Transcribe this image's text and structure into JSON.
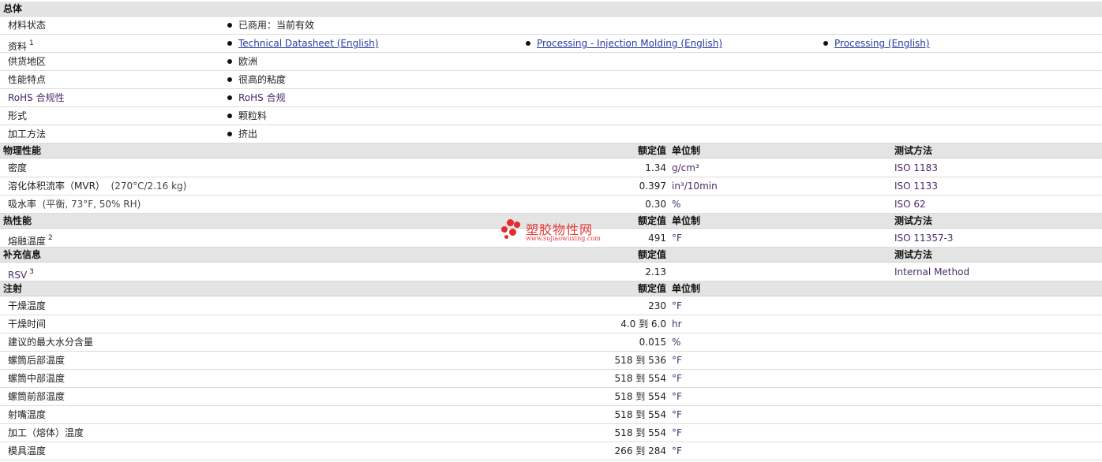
{
  "general": {
    "header": "总体",
    "rows": [
      {
        "label": "材料状态",
        "values": [
          "已商用：当前有效"
        ]
      },
      {
        "label": "资料",
        "sup": "1",
        "links": [
          "Technical Datasheet (English)",
          "Processing - Injection Molding (English)",
          "Processing (English)"
        ]
      },
      {
        "label": "供货地区",
        "values": [
          "欧洲"
        ]
      },
      {
        "label": "性能特点",
        "values": [
          "很高的粘度"
        ]
      },
      {
        "label": "RoHS 合规性",
        "values": [
          "RoHS 合规"
        ]
      },
      {
        "label": "形式",
        "values": [
          "颗粒料"
        ]
      },
      {
        "label": "加工方法",
        "values": [
          "挤出"
        ]
      }
    ]
  },
  "physical": {
    "header": "物理性能",
    "col_value": "额定值",
    "col_unit": "单位制",
    "col_test": "测试方法",
    "rows": [
      {
        "label": "密度",
        "cond": "",
        "value": "1.34",
        "unit": "g/cm³",
        "test": "ISO 1183"
      },
      {
        "label": "溶化体积流率（MVR）",
        "cond": "(270°C/2.16 kg)",
        "value": "0.397",
        "unit": "in³/10min",
        "test": "ISO 1133"
      },
      {
        "label": "吸水率",
        "cond": "(平衡, 73°F, 50% RH)",
        "value": "0.30",
        "unit": "%",
        "test": "ISO 62"
      }
    ]
  },
  "thermal": {
    "header": "热性能",
    "col_value": "额定值",
    "col_unit": "单位制",
    "col_test": "测试方法",
    "rows": [
      {
        "label": "熔融温度",
        "sup": "2",
        "value": "491",
        "unit": "°F",
        "test": "ISO 11357-3"
      }
    ]
  },
  "supplemental": {
    "header": "补充信息",
    "col_value": "额定值",
    "col_test": "测试方法",
    "rows": [
      {
        "label": "RSV",
        "sup": "3",
        "value": "2.13",
        "unit": "",
        "test": "Internal Method"
      }
    ]
  },
  "injection": {
    "header": "注射",
    "col_value": "额定值",
    "col_unit": "单位制",
    "rows": [
      {
        "label": "干燥温度",
        "value": "230",
        "unit": "°F"
      },
      {
        "label": "干燥时间",
        "value": "4.0 到  6.0",
        "unit": "hr"
      },
      {
        "label": "建议的最大水分含量",
        "value": "0.015",
        "unit": "%"
      },
      {
        "label": "螺筒后部温度",
        "value": "518 到  536",
        "unit": "°F"
      },
      {
        "label": "螺筒中部温度",
        "value": "518 到  554",
        "unit": "°F"
      },
      {
        "label": "螺筒前部温度",
        "value": "518 到  554",
        "unit": "°F"
      },
      {
        "label": "射嘴温度",
        "value": "518 到  554",
        "unit": "°F"
      },
      {
        "label": "加工（熔体）温度",
        "value": "518 到  554",
        "unit": "°F"
      },
      {
        "label": "模具温度",
        "value": "266 到  284",
        "unit": "°F"
      }
    ]
  },
  "watermark": {
    "title": "塑胶物性网",
    "url": "www.sujiaowuxing.com",
    "color": "#e63a3a"
  }
}
